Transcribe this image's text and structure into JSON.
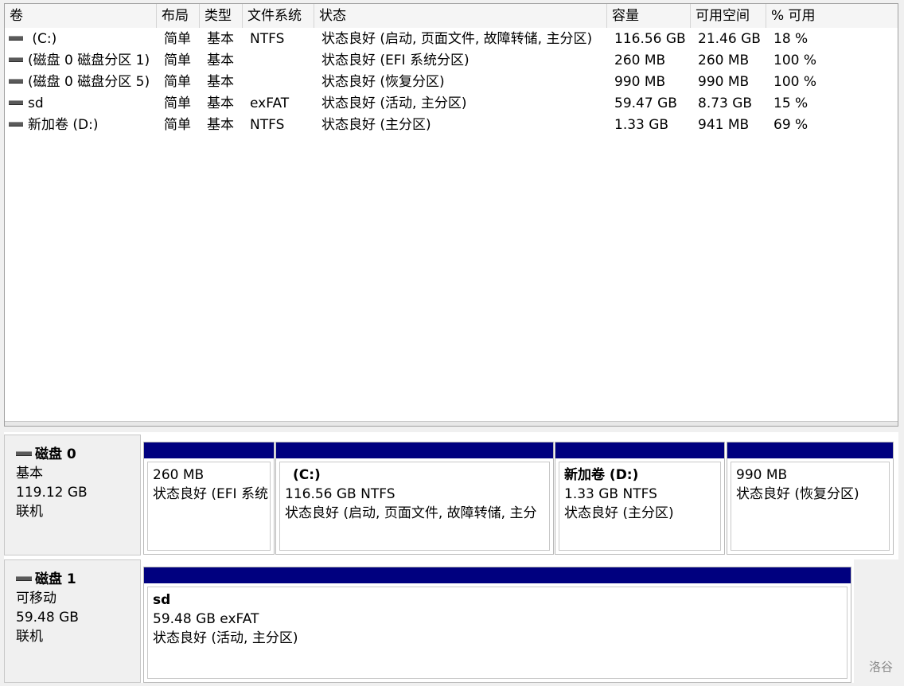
{
  "volume_list": {
    "columns": [
      "卷",
      "布局",
      "类型",
      "文件系统",
      "状态",
      "容量",
      "可用空间",
      "% 可用"
    ],
    "rows": [
      {
        "volume": " (C:)",
        "layout": "简单",
        "type": "基本",
        "fs": "NTFS",
        "status": "状态良好 (启动, 页面文件, 故障转储, 主分区)",
        "capacity": "116.56 GB",
        "free": "21.46 GB",
        "pct": "18 %"
      },
      {
        "volume": "(磁盘 0 磁盘分区 1)",
        "layout": "简单",
        "type": "基本",
        "fs": "",
        "status": "状态良好 (EFI 系统分区)",
        "capacity": "260 MB",
        "free": "260 MB",
        "pct": "100 %"
      },
      {
        "volume": "(磁盘 0 磁盘分区 5)",
        "layout": "简单",
        "type": "基本",
        "fs": "",
        "status": "状态良好 (恢复分区)",
        "capacity": "990 MB",
        "free": "990 MB",
        "pct": "100 %"
      },
      {
        "volume": "sd",
        "layout": "简单",
        "type": "基本",
        "fs": "exFAT",
        "status": "状态良好 (活动, 主分区)",
        "capacity": "59.47 GB",
        "free": "8.73 GB",
        "pct": "15 %"
      },
      {
        "volume": "新加卷 (D:)",
        "layout": "简单",
        "type": "基本",
        "fs": "NTFS",
        "status": "状态良好 (主分区)",
        "capacity": "1.33 GB",
        "free": "941 MB",
        "pct": "69 %"
      }
    ]
  },
  "disks": [
    {
      "name": "磁盘 0",
      "kind": "基本",
      "size": "119.12 GB",
      "state": "联机",
      "partitions": [
        {
          "name": "",
          "line1": "260 MB",
          "line2": "状态良好 (EFI 系统"
        },
        {
          "name": "(C:)",
          "line1": "116.56 GB NTFS",
          "line2": "状态良好 (启动, 页面文件, 故障转储, 主分"
        },
        {
          "name": "新加卷  (D:)",
          "line1": "1.33 GB NTFS",
          "line2": "状态良好 (主分区)"
        },
        {
          "name": "",
          "line1": "990 MB",
          "line2": "状态良好 (恢复分区)"
        }
      ]
    },
    {
      "name": "磁盘 1",
      "kind": "可移动",
      "size": "59.48 GB",
      "state": "联机",
      "partitions": [
        {
          "name": "sd",
          "line1": "59.48 GB exFAT",
          "line2": "状态良好 (活动, 主分区)"
        }
      ]
    }
  ],
  "watermark": "洛谷",
  "colors": {
    "partition_bar": "#00007f"
  }
}
